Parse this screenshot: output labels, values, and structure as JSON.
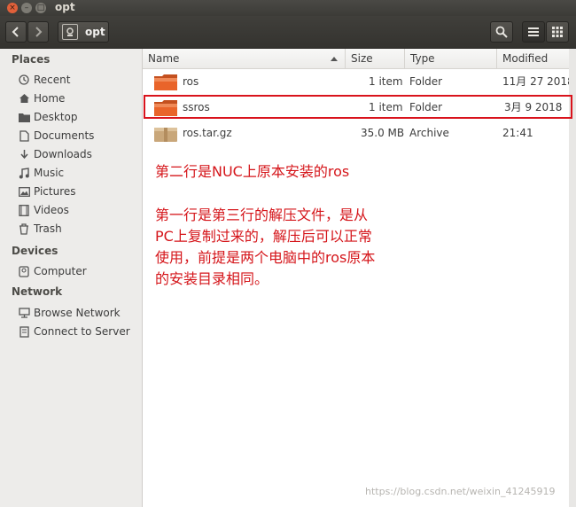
{
  "window": {
    "title": "opt"
  },
  "toolbar": {
    "path_label": "opt"
  },
  "sidebar": {
    "places_title": "Places",
    "places": [
      "Recent",
      "Home",
      "Desktop",
      "Documents",
      "Downloads",
      "Music",
      "Pictures",
      "Videos",
      "Trash"
    ],
    "devices_title": "Devices",
    "devices": [
      "Computer"
    ],
    "network_title": "Network",
    "network": [
      "Browse Network",
      "Connect to Server"
    ]
  },
  "columns": {
    "name": "Name",
    "size": "Size",
    "type": "Type",
    "modified": "Modified"
  },
  "files": [
    {
      "name": "ros",
      "size": "1 item",
      "type": "Folder",
      "modified": "11月 27 2018"
    },
    {
      "name": "ssros",
      "size": "1 item",
      "type": "Folder",
      "modified": "3月 9 2018"
    },
    {
      "name": "ros.tar.gz",
      "size": "35.0 MB",
      "type": "Archive",
      "modified": "21:41"
    }
  ],
  "annotation": {
    "line1": "第二行是NUC上原本安装的ros",
    "line2": "第一行是第三行的解压文件，是从",
    "line3": "PC上复制过来的，解压后可以正常",
    "line4": "使用，前提是两个电脑中的ros原本",
    "line5": "的安装目录相同。"
  },
  "watermark": "https://blog.csdn.net/weixin_41245919",
  "colors": {
    "annotation_red": "#d5151a",
    "folder_orange": "#e9642a",
    "titlebar": "#3c3b37"
  }
}
